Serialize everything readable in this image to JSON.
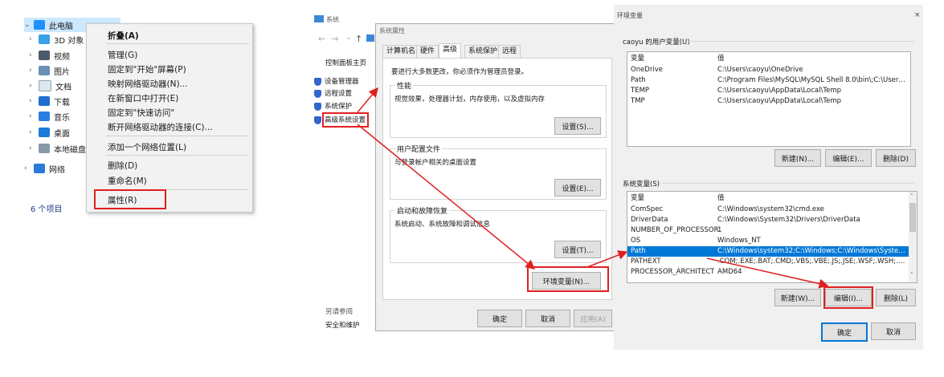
{
  "explorer": {
    "root": "此电脑",
    "items": [
      "3D 对象",
      "视频",
      "图片",
      "文档",
      "下载",
      "音乐",
      "桌面",
      "本地磁盘"
    ],
    "network": "网络",
    "count": "6 个项目"
  },
  "context_menu": {
    "items": [
      "折叠(A)",
      "管理(G)",
      "固定到\"开始\"屏幕(P)",
      "映射网络驱动器(N)...",
      "在新窗口中打开(E)",
      "固定到\"快速访问\"",
      "断开网络驱动器的连接(C)...",
      "添加一个网络位置(L)",
      "删除(D)",
      "重命名(M)",
      "属性(R)"
    ]
  },
  "system_window": {
    "title": "系统",
    "home": "控制面板主页",
    "links": [
      "设备管理器",
      "远程设置",
      "系统保护",
      "高级系统设置"
    ],
    "see_also": "另请参阅",
    "security": "安全和维护"
  },
  "properties": {
    "title": "系统属性",
    "tabs": [
      "计算机名",
      "硬件",
      "高级",
      "系统保护",
      "远程"
    ],
    "admin_note": "要进行大多数更改，你必须作为管理员登录。",
    "perf_title": "性能",
    "perf_desc": "视觉效果，处理器计划，内存使用，以及虚拟内存",
    "settings_btn": "设置(S)...",
    "profile_title": "用户配置文件",
    "profile_desc": "与登录帐户相关的桌面设置",
    "profile_btn": "设置(E)...",
    "startup_title": "启动和故障恢复",
    "startup_desc": "系统启动、系统故障和调试信息",
    "startup_btn": "设置(T)...",
    "env_btn": "环境变量(N)...",
    "ok": "确定",
    "cancel": "取消",
    "apply": "应用(A)"
  },
  "env": {
    "title": "环境变量",
    "user_group": "caoyu 的用户变量(U)",
    "system_group": "系统变量(S)",
    "col_var": "变量",
    "col_val": "值",
    "user_vars": [
      {
        "name": "OneDrive",
        "value": "C:\\Users\\caoyu\\OneDrive"
      },
      {
        "name": "Path",
        "value": "C:\\Program Files\\MySQL\\MySQL Shell 8.0\\bin\\;C:\\Users\\caoyu..."
      },
      {
        "name": "TEMP",
        "value": "C:\\Users\\caoyu\\AppData\\Local\\Temp"
      },
      {
        "name": "TMP",
        "value": "C:\\Users\\caoyu\\AppData\\Local\\Temp"
      }
    ],
    "system_vars": [
      {
        "name": "ComSpec",
        "value": "C:\\Windows\\system32\\cmd.exe"
      },
      {
        "name": "DriverData",
        "value": "C:\\Windows\\System32\\Drivers\\DriverData"
      },
      {
        "name": "NUMBER_OF_PROCESSORS",
        "value": "1"
      },
      {
        "name": "OS",
        "value": "Windows_NT"
      },
      {
        "name": "Path",
        "value": "C:\\Windows\\system32;C:\\Windows;C:\\Windows\\System32\\Wb..."
      },
      {
        "name": "PATHEXT",
        "value": ".COM;.EXE;.BAT;.CMD;.VBS;.VBE;.JS;.JSE;.WSF;.WSH;.MSC"
      },
      {
        "name": "PROCESSOR_ARCHITECT...",
        "value": "AMD64"
      }
    ],
    "user_btns": [
      "新建(N)...",
      "编辑(E)...",
      "删除(D)"
    ],
    "system_btns": [
      "新建(W)...",
      "编辑(I)...",
      "删除(L)"
    ],
    "ok": "确定",
    "cancel": "取消"
  },
  "colors": {
    "highlight": "#e02020",
    "selection": "#0078d7",
    "tree_selection": "#cce8ff"
  }
}
